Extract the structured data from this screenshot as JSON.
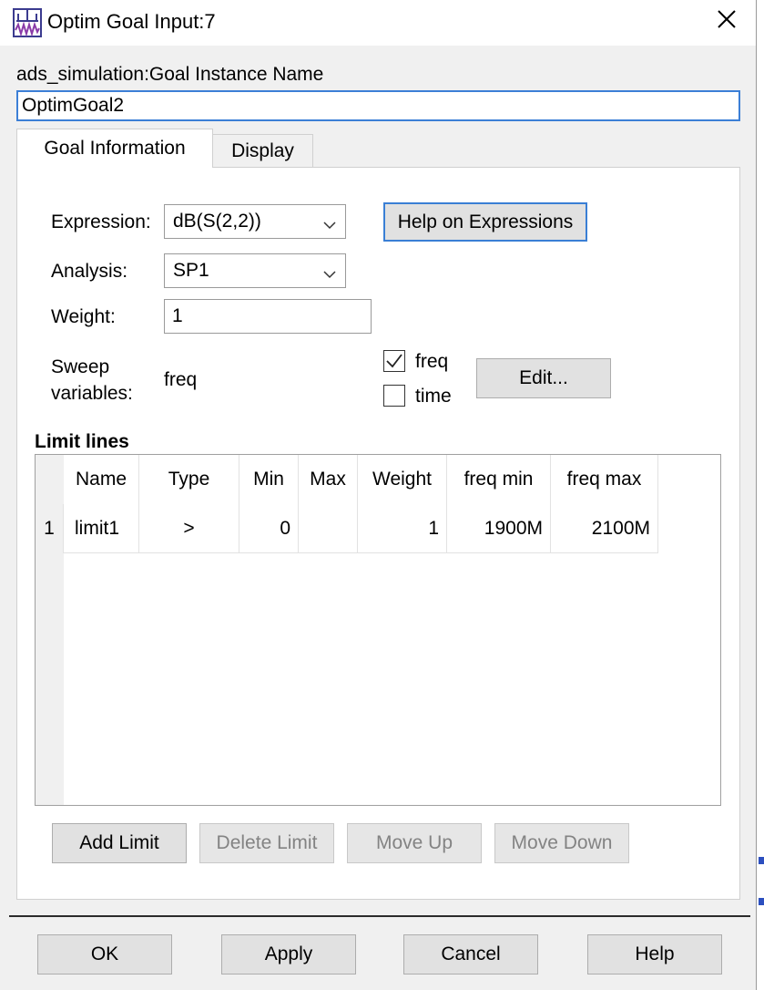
{
  "window": {
    "title": "Optim Goal Input:7",
    "close_symbol": "✕"
  },
  "instance": {
    "label": "ads_simulation:Goal Instance Name",
    "value": "OptimGoal2"
  },
  "tabs": [
    {
      "label": "Goal Information",
      "active": true
    },
    {
      "label": "Display",
      "active": false
    }
  ],
  "form": {
    "expression_label": "Expression:",
    "expression_value": "dB(S(2,2))",
    "help_button": "Help on Expressions",
    "analysis_label": "Analysis:",
    "analysis_value": "SP1",
    "weight_label": "Weight:",
    "weight_value": "1",
    "sweep_label_1": "Sweep",
    "sweep_label_2": "variables:",
    "sweep_value": "freq",
    "checkboxes": [
      {
        "label": "freq",
        "checked": true
      },
      {
        "label": "time",
        "checked": false
      }
    ],
    "edit_button": "Edit..."
  },
  "limits": {
    "title": "Limit lines",
    "columns": [
      "Name",
      "Type",
      "Min",
      "Max",
      "Weight",
      "freq min",
      "freq max"
    ],
    "rows": [
      {
        "index": "1",
        "cells": [
          "limit1",
          ">",
          "0",
          "",
          "1",
          "1900M",
          "2100M"
        ]
      }
    ],
    "buttons": [
      {
        "label": "Add Limit",
        "enabled": true
      },
      {
        "label": "Delete Limit",
        "enabled": false
      },
      {
        "label": "Move Up",
        "enabled": false
      },
      {
        "label": "Move Down",
        "enabled": false
      }
    ]
  },
  "footer": {
    "ok": "OK",
    "apply": "Apply",
    "cancel": "Cancel",
    "help": "Help"
  },
  "colors": {
    "focus": "#3a7fd5",
    "button_bg": "#e1e1e1",
    "disabled_text": "#838383"
  }
}
